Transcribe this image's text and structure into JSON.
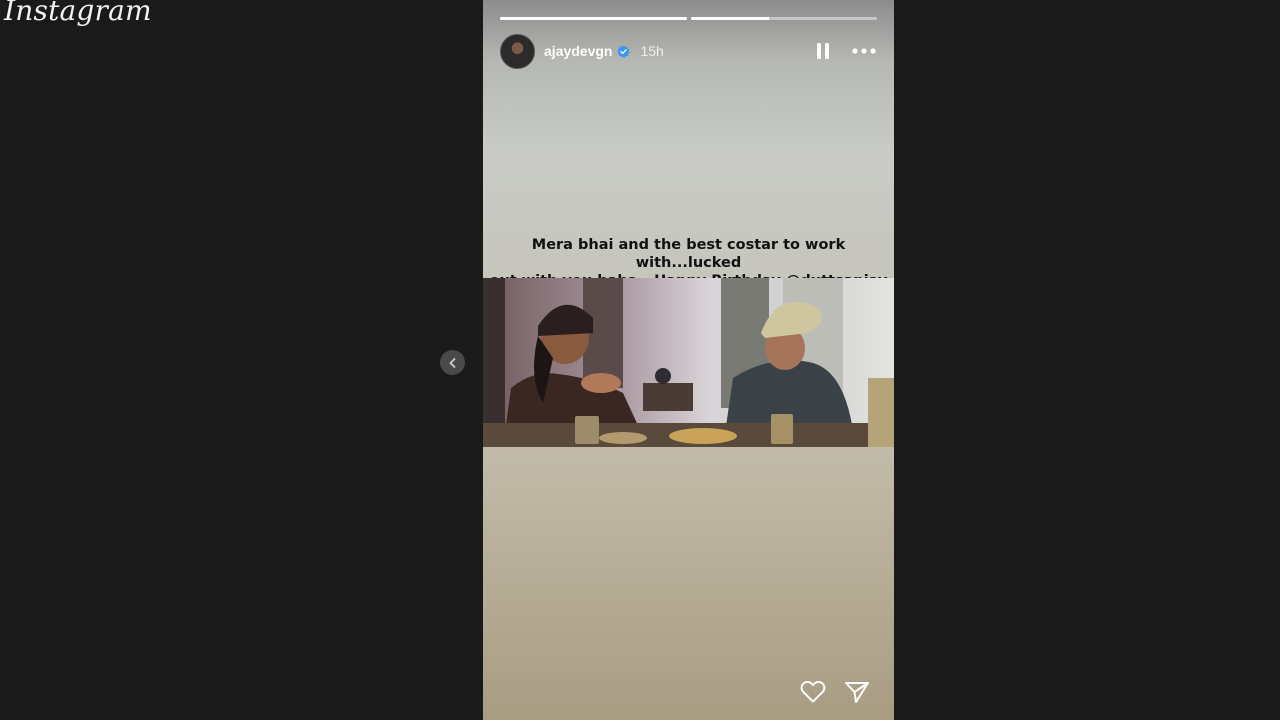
{
  "app": {
    "logo_text": "Instagram"
  },
  "story": {
    "username": "ajaydevgn",
    "time": "15h",
    "progress": [
      1.0,
      0.42
    ],
    "caption_line1": "Mera bhai and the best costar to work with...lucked",
    "caption_line2_prefix": "out with you baba...Happy Birthday ",
    "caption_mention": "@duttsanjay",
    "caption_emoji": "🤝"
  },
  "icons": {
    "prev": "chevron-left-icon",
    "pause": "pause-icon",
    "more": "more-options-icon",
    "verified": "verified-badge-icon",
    "like": "heart-icon",
    "share": "send-icon"
  },
  "colors": {
    "page_bg": "#1a1a1a",
    "verified_blue": "#3897f0",
    "white": "#ffffff"
  }
}
